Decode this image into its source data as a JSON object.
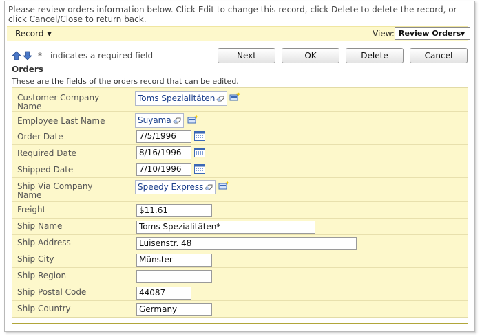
{
  "description": "Please review orders information below. Click Edit to change this record, click Delete to delete the record, or click Cancel/Close to return back.",
  "actionbar": {
    "record_menu": "Record",
    "view_label": "View:",
    "view_selected": "Review Orders"
  },
  "required_note": "* - indicates a required field",
  "buttons": {
    "next": "Next",
    "ok": "OK",
    "delete": "Delete",
    "cancel": "Cancel"
  },
  "section": {
    "title": "Orders",
    "description": "These are the fields of the orders record that can be edited."
  },
  "fields": {
    "customer_company": {
      "label": "Customer Company Name",
      "value": "Toms Spezialitäten"
    },
    "employee_last_name": {
      "label": "Employee Last Name",
      "value": "Suyama"
    },
    "order_date": {
      "label": "Order Date",
      "value": "7/5/1996"
    },
    "required_date": {
      "label": "Required Date",
      "value": "8/16/1996"
    },
    "shipped_date": {
      "label": "Shipped Date",
      "value": "7/10/1996"
    },
    "ship_via_company": {
      "label": "Ship Via Company Name",
      "value": "Speedy Express"
    },
    "freight": {
      "label": "Freight",
      "value": "$11.61"
    },
    "ship_name": {
      "label": "Ship Name",
      "value": "Toms Spezialitäten*"
    },
    "ship_address": {
      "label": "Ship Address",
      "value": "Luisenstr. 48"
    },
    "ship_city": {
      "label": "Ship City",
      "value": "Münster"
    },
    "ship_region": {
      "label": "Ship Region",
      "value": ""
    },
    "ship_postal_code": {
      "label": "Ship Postal Code",
      "value": "44087"
    },
    "ship_country": {
      "label": "Ship Country",
      "value": "Germany"
    }
  },
  "icons": {
    "move_up": "arrow-up-icon",
    "move_down": "arrow-down-icon",
    "clear": "eraser-icon",
    "new": "new-record-icon",
    "calendar": "calendar-icon",
    "dropdown": "triangle-down-icon"
  },
  "colors": {
    "band": "#fdf8cb",
    "link": "#1b3f8b",
    "accent_line": "#b1a63a"
  }
}
